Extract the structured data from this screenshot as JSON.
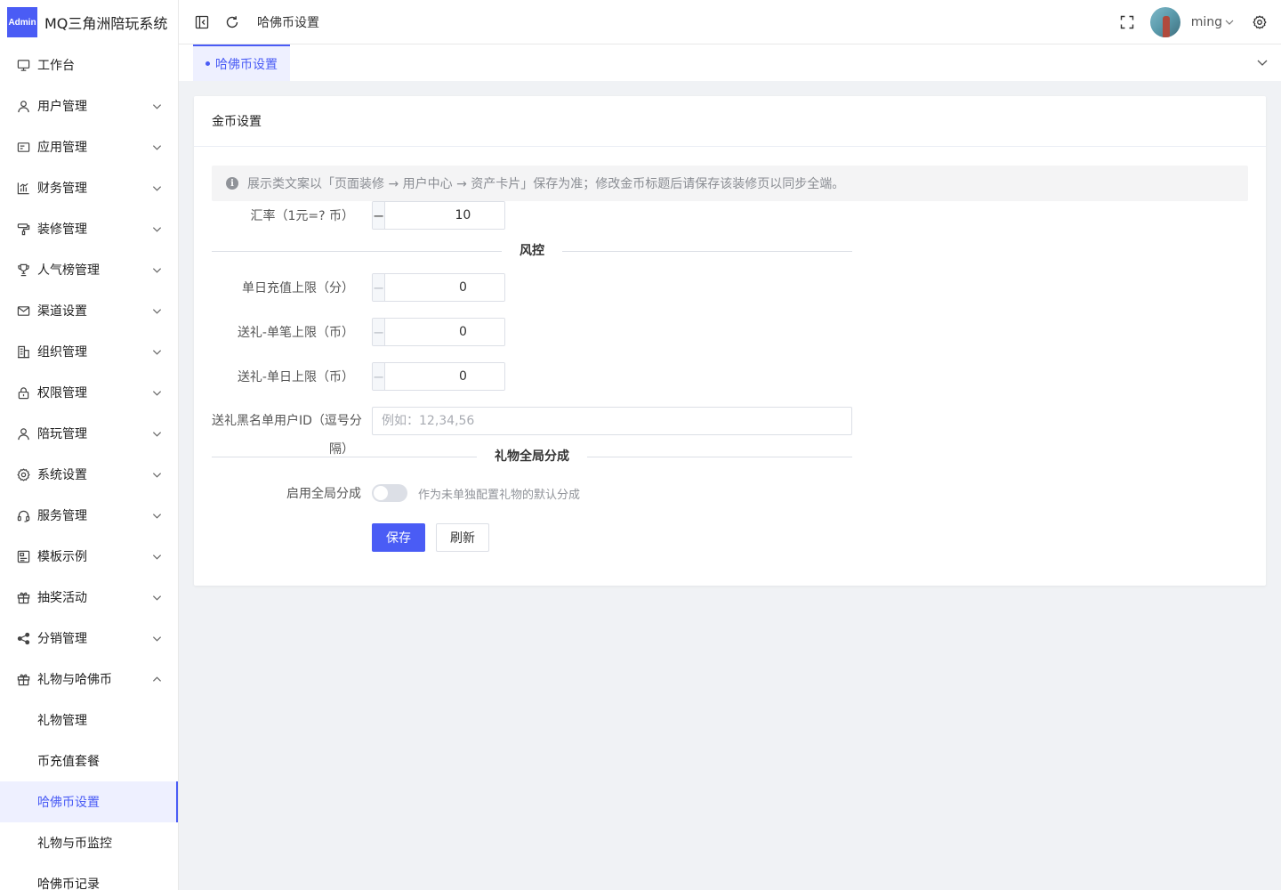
{
  "brand": {
    "logo_text": "Admin",
    "title": "MQ三角洲陪玩系统"
  },
  "sidebar": {
    "items": [
      {
        "label": "工作台",
        "icon": "monitor-icon",
        "has_arrow": false
      },
      {
        "label": "用户管理",
        "icon": "user-icon",
        "has_arrow": true
      },
      {
        "label": "应用管理",
        "icon": "app-card-icon",
        "has_arrow": true
      },
      {
        "label": "财务管理",
        "icon": "bar-chart-icon",
        "has_arrow": true
      },
      {
        "label": "装修管理",
        "icon": "paint-roller-icon",
        "has_arrow": true
      },
      {
        "label": "人气榜管理",
        "icon": "trophy-icon",
        "has_arrow": true
      },
      {
        "label": "渠道设置",
        "icon": "mail-icon",
        "has_arrow": true
      },
      {
        "label": "组织管理",
        "icon": "building-icon",
        "has_arrow": true
      },
      {
        "label": "权限管理",
        "icon": "lock-icon",
        "has_arrow": true
      },
      {
        "label": "陪玩管理",
        "icon": "user-icon",
        "has_arrow": true
      },
      {
        "label": "系统设置",
        "icon": "gear-icon",
        "has_arrow": true
      },
      {
        "label": "服务管理",
        "icon": "headset-icon",
        "has_arrow": true
      },
      {
        "label": "模板示例",
        "icon": "template-icon",
        "has_arrow": true
      },
      {
        "label": "抽奖活动",
        "icon": "gift-icon",
        "has_arrow": true
      },
      {
        "label": "分销管理",
        "icon": "share-icon",
        "has_arrow": true
      },
      {
        "label": "礼物与哈佛币",
        "icon": "gift-icon",
        "has_arrow": true,
        "expanded": true
      }
    ],
    "submenu": [
      {
        "label": "礼物管理",
        "active": false
      },
      {
        "label": "币充值套餐",
        "active": false
      },
      {
        "label": "哈佛币设置",
        "active": true
      },
      {
        "label": "礼物与币监控",
        "active": false
      },
      {
        "label": "哈佛币记录",
        "active": false
      }
    ]
  },
  "header": {
    "breadcrumb": "哈佛币设置",
    "username": "ming"
  },
  "tabs": [
    {
      "label": "哈佛币设置",
      "active": true
    }
  ],
  "card": {
    "title": "金币设置",
    "alert": "展示类文案以「页面装修 → 用户中心 → 资产卡片」保存为准；修改金币标题后请保存该装修页以同步全端。",
    "exchange": {
      "label": "汇率（1元=? 币）",
      "value": "10"
    },
    "risk_divider": "风控",
    "daily_recharge": {
      "label": "单日充值上限（分）",
      "value": "0"
    },
    "gift_single": {
      "label": "送礼-单笔上限（币）",
      "value": "0"
    },
    "gift_daily": {
      "label": "送礼-单日上限（币）",
      "value": "0"
    },
    "blacklist": {
      "label_line1": "送礼黑名单用户ID（逗号分",
      "label_line2": "隔）",
      "placeholder": "例如：12,34,56",
      "value": ""
    },
    "split_divider": "礼物全局分成",
    "global_split": {
      "label": "启用全局分成",
      "enabled": false,
      "hint": "作为未单独配置礼物的默认分成"
    },
    "save_label": "保存",
    "refresh_label": "刷新"
  },
  "colors": {
    "accent": "#4a5cf5",
    "active_bg": "#eef0ff"
  }
}
